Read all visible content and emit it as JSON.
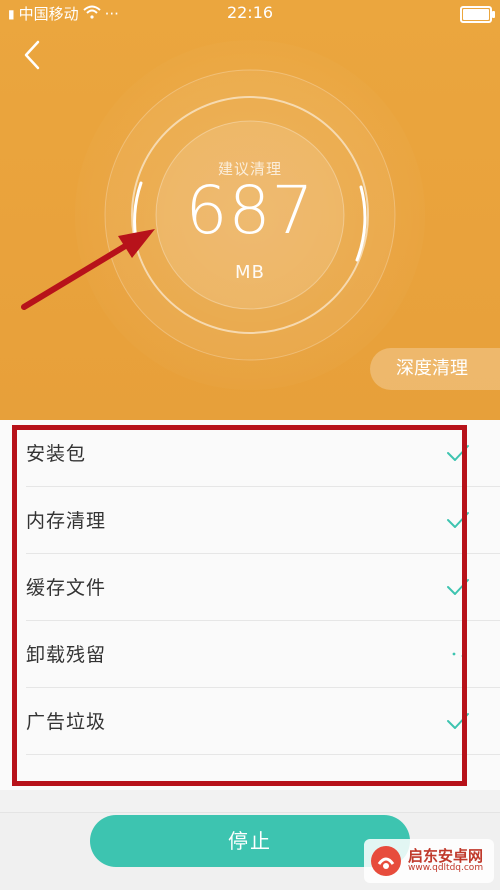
{
  "status": {
    "carrier": "中国移动",
    "time": "22:16"
  },
  "gauge": {
    "label": "建议清理",
    "value": "687",
    "unit": "MB"
  },
  "deep_clean_label": "深度清理",
  "items": [
    {
      "label": "安装包",
      "state": "done"
    },
    {
      "label": "内存清理",
      "state": "done"
    },
    {
      "label": "缓存文件",
      "state": "done"
    },
    {
      "label": "卸载残留",
      "state": "scanning"
    },
    {
      "label": "广告垃圾",
      "state": "done"
    }
  ],
  "stop_label": "停止",
  "watermark": {
    "name": "启东安卓网",
    "url": "www.qdltdq.com"
  },
  "colors": {
    "hero": "#e9a23c",
    "accent": "#3dc4b0",
    "annotation": "#b7121a"
  }
}
